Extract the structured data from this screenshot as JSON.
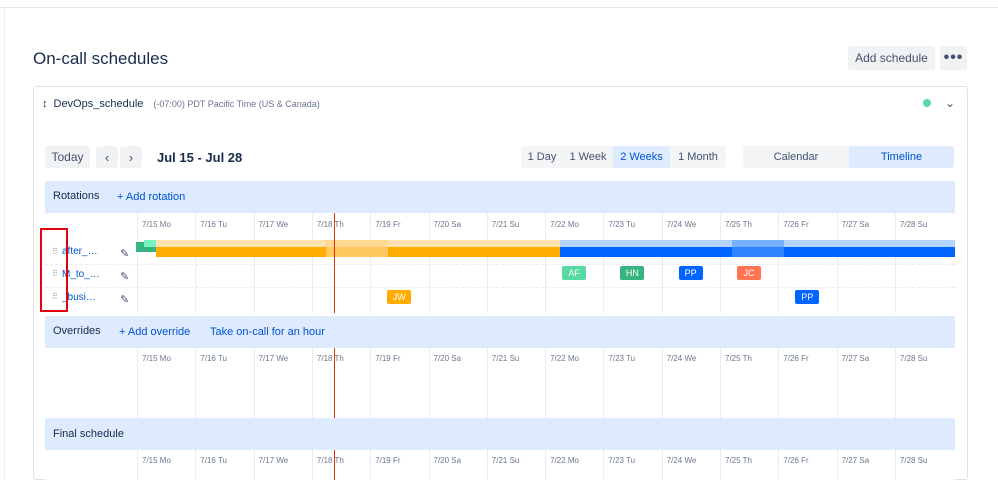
{
  "page": {
    "title": "On-call schedules",
    "add_schedule": "Add schedule",
    "more": "•••"
  },
  "schedule": {
    "expand_glyph": "↕",
    "name": "DevOps_schedule",
    "timezone": "(-07:00) PDT Pacific Time (US & Canada)",
    "status_color": "#57d9a3",
    "collapse_glyph": "⌄"
  },
  "toolbar": {
    "today": "Today",
    "prev": "‹",
    "next": "›",
    "range": "Jul 15 - Jul 28",
    "spans": [
      "1 Day",
      "1 Week",
      "2 Weeks",
      "1 Month"
    ],
    "active_span": "2 Weeks",
    "views": [
      "Calendar",
      "Timeline"
    ],
    "active_view": "Timeline"
  },
  "days": [
    "7/15 Mo",
    "7/16 Tu",
    "7/17 We",
    "7/18 Th",
    "7/19 Fr",
    "7/20 Sa",
    "7/21 Su",
    "7/22 Mo",
    "7/23 Tu",
    "7/24 We",
    "7/25 Th",
    "7/26 Fr",
    "7/27 Sa",
    "7/28 Su"
  ],
  "rotations": {
    "title": "Rotations",
    "add": "+ Add rotation",
    "rows": [
      {
        "label": "after_…",
        "drag": "⠿",
        "edit": "✎"
      },
      {
        "label": "M_to_…",
        "drag": "⠿",
        "edit": "✎"
      },
      {
        "label": "_busi…",
        "drag": "⠿",
        "edit": "✎"
      }
    ],
    "badges": [
      {
        "row": 1,
        "day": 7,
        "text": "AF",
        "color": "#57d9a3"
      },
      {
        "row": 1,
        "day": 8,
        "text": "HN",
        "color": "#36b37e"
      },
      {
        "row": 1,
        "day": 9,
        "text": "PP",
        "color": "#0065ff"
      },
      {
        "row": 1,
        "day": 10,
        "text": "JC",
        "color": "#ff7452"
      },
      {
        "row": 2,
        "day": 4,
        "text": "JW",
        "color": "#ffab00"
      },
      {
        "row": 2,
        "day": 11,
        "text": "PP",
        "color": "#0065ff"
      }
    ]
  },
  "overrides": {
    "title": "Overrides",
    "add": "+ Add override",
    "take": "Take on-call for an hour"
  },
  "final": {
    "title": "Final schedule"
  },
  "colors": {
    "accent": "#0052cc",
    "band": "#deebff",
    "orange": "#ffab00",
    "blue": "#0065ff",
    "green": "#36b37e",
    "now_line": "#de350b"
  }
}
